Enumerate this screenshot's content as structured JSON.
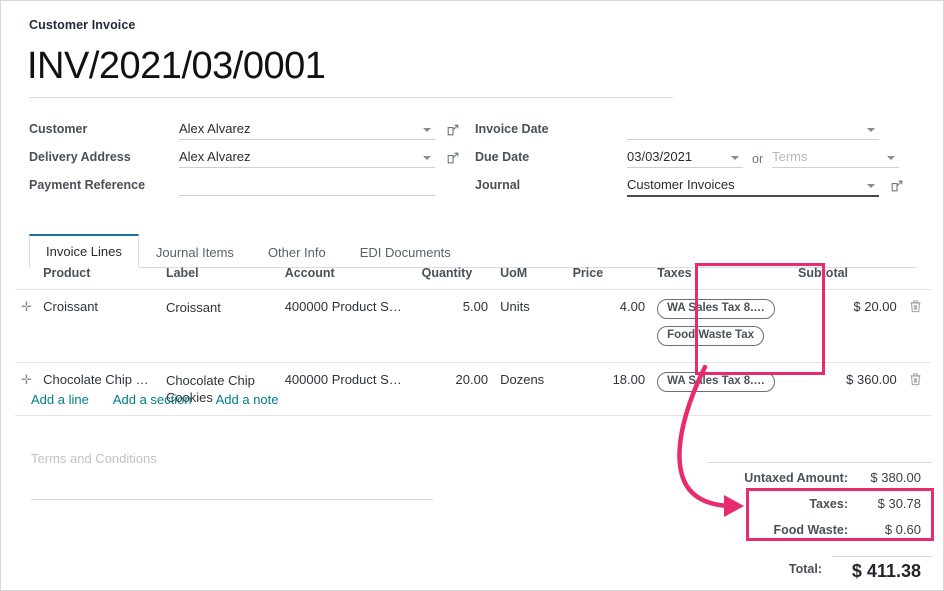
{
  "header": {
    "doc_type": "Customer Invoice",
    "title": "INV/2021/03/0001"
  },
  "form": {
    "left": [
      {
        "label": "Customer",
        "value": "Alex Alvarez",
        "placeholder": "",
        "has_caret": true,
        "has_ext_link": true,
        "focused": false
      },
      {
        "label": "Delivery Address",
        "value": "Alex Alvarez",
        "placeholder": "",
        "has_caret": true,
        "has_ext_link": true,
        "focused": false
      },
      {
        "label": "Payment Reference",
        "value": "",
        "placeholder": "",
        "has_caret": false,
        "has_ext_link": false,
        "focused": false
      }
    ],
    "right": {
      "invoice_date_label": "Invoice Date",
      "invoice_date_value": "",
      "due_date_label": "Due Date",
      "due_date_value": "03/03/2021",
      "or_label": "or",
      "terms_placeholder": "Terms",
      "journal_label": "Journal",
      "journal_value": "Customer Invoices"
    }
  },
  "tabs": [
    {
      "label": "Invoice Lines",
      "active": true
    },
    {
      "label": "Journal Items",
      "active": false
    },
    {
      "label": "Other Info",
      "active": false
    },
    {
      "label": "EDI Documents",
      "active": false
    }
  ],
  "lines_table": {
    "columns": [
      "Product",
      "Label",
      "Account",
      "Quantity",
      "UoM",
      "Price",
      "Taxes",
      "Subtotal"
    ],
    "rows": [
      {
        "handle": "drag-handle",
        "product": "Croissant",
        "label": "Croissant",
        "account": "400000 Product S…",
        "quantity": "5.00",
        "uom": "Units",
        "price": "4.00",
        "taxes": [
          "WA Sales Tax 8.…",
          "Food Waste Tax"
        ],
        "subtotal": "$ 20.00"
      },
      {
        "handle": "drag-handle",
        "product": "Chocolate Chip C…",
        "label": "Chocolate Chip Cookies",
        "account": "400000 Product S…",
        "quantity": "20.00",
        "uom": "Dozens",
        "price": "18.00",
        "taxes": [
          "WA Sales Tax 8.…"
        ],
        "subtotal": "$ 360.00"
      }
    ]
  },
  "add_links": [
    {
      "label": "Add a line"
    },
    {
      "label": "Add a section"
    },
    {
      "label": "Add a note"
    }
  ],
  "terms": {
    "placeholder": "Terms and Conditions"
  },
  "totals": {
    "rows": [
      {
        "label": "Untaxed Amount:",
        "value": "$ 380.00"
      },
      {
        "label": "Taxes:",
        "value": "$ 30.78"
      },
      {
        "label": "Food Waste:",
        "value": "$ 0.60"
      }
    ],
    "total_label": "Total:",
    "total_value": "$ 411.38"
  },
  "annotations": {
    "highlight_color": "#e82a6e",
    "boxes": [
      "taxes-column",
      "tax-totals"
    ],
    "arrow": "curved-arrow-taxes-to-totals"
  },
  "colors": {
    "accent_link": "#017e84",
    "active_tab_border": "#1f6fa5",
    "annotation_pink": "#e82a6e"
  }
}
